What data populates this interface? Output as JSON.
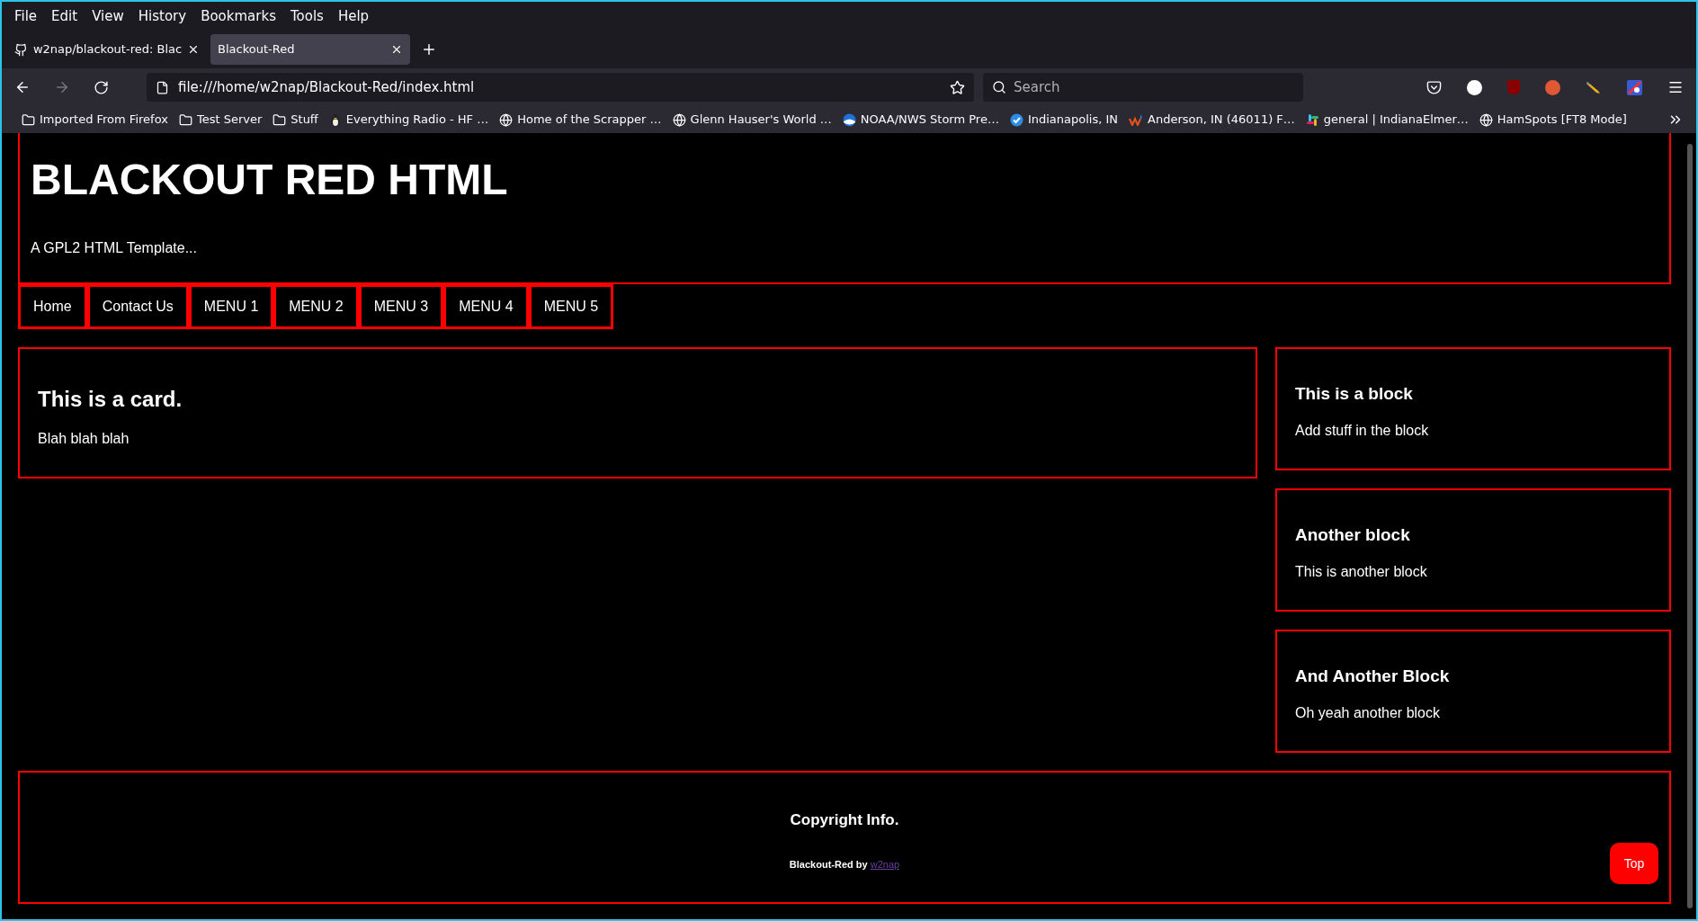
{
  "menu_bar": [
    "File",
    "Edit",
    "View",
    "History",
    "Bookmarks",
    "Tools",
    "Help"
  ],
  "tabs": [
    {
      "label": "w2nap/blackout-red: Blac",
      "selected": false,
      "kind": "github"
    },
    {
      "label": "Blackout-Red",
      "selected": true,
      "kind": "plain"
    }
  ],
  "address": "file:///home/w2nap/Blackout-Red/index.html",
  "search": {
    "placeholder": "Search"
  },
  "bookmarks": [
    {
      "label": "Imported From Firefox",
      "kind": "folder"
    },
    {
      "label": "Test Server",
      "kind": "folder"
    },
    {
      "label": "Stuff",
      "kind": "folder"
    },
    {
      "label": "Everything Radio - HF …",
      "kind": "penguin"
    },
    {
      "label": "Home of the Scrapper …",
      "kind": "globe"
    },
    {
      "label": "Glenn Hauser's World …",
      "kind": "globe"
    },
    {
      "label": "NOAA/NWS Storm Pre…",
      "kind": "noaa"
    },
    {
      "label": "Indianapolis, IN",
      "kind": "check"
    },
    {
      "label": "Anderson, IN (46011) F…",
      "kind": "wu"
    },
    {
      "label": "general | IndianaElmer…",
      "kind": "slack"
    },
    {
      "label": "HamSpots [FT8 Mode]",
      "kind": "globe"
    }
  ],
  "page": {
    "title": "BLACKOUT RED HTML",
    "subtitle": "A GPL2 HTML Template...",
    "nav": [
      "Home",
      "Contact Us",
      "MENU 1",
      "MENU 2",
      "MENU 3",
      "MENU 4",
      "MENU 5"
    ],
    "card": {
      "title": "This is a card.",
      "text": "Blah blah blah"
    },
    "blocks": [
      {
        "title": "This is a block",
        "text": "Add stuff in the block"
      },
      {
        "title": "Another block",
        "text": "This is another block"
      },
      {
        "title": "And Another Block",
        "text": "Oh yeah another block"
      }
    ],
    "footer": {
      "title": "Copyright Info.",
      "credit": "Blackout-Red by",
      "link": "w2nap"
    },
    "top_button": "Top"
  }
}
